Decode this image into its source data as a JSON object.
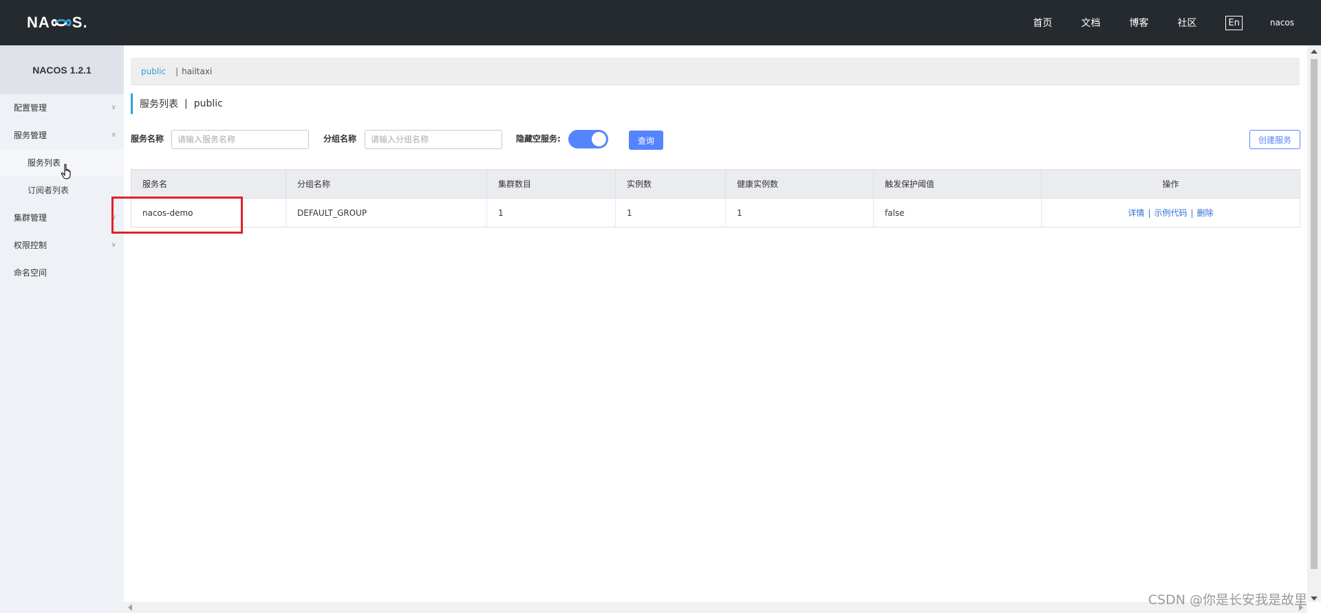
{
  "header": {
    "logo_text": "NACOS.",
    "nav": [
      "首页",
      "文档",
      "博客",
      "社区"
    ],
    "lang": "En",
    "user": "nacos"
  },
  "sidebar": {
    "title": "NACOS 1.2.1",
    "items": [
      {
        "label": "配置管理",
        "chevron": "chevron-down"
      },
      {
        "label": "服务管理",
        "chevron": "chevron-up"
      },
      {
        "label": "集群管理",
        "chevron": "chevron-down"
      },
      {
        "label": "权限控制",
        "chevron": "chevron-down"
      },
      {
        "label": "命名空间"
      }
    ],
    "sub_items": [
      "服务列表",
      "订阅者列表"
    ]
  },
  "namespace_bar": {
    "active": "public",
    "other": "hailtaxi",
    "sep": "|"
  },
  "page_title": {
    "label": "服务列表",
    "sep": "|",
    "namespace": "public"
  },
  "filter": {
    "service_name_label": "服务名称",
    "service_name_placeholder": "请输入服务名称",
    "group_name_label": "分组名称",
    "group_name_placeholder": "请输入分组名称",
    "hide_empty_label": "隐藏空服务:",
    "hide_empty_on": true,
    "query_label": "查询",
    "create_label": "创建服务"
  },
  "table": {
    "headers": [
      "服务名",
      "分组名称",
      "集群数目",
      "实例数",
      "健康实例数",
      "触发保护阈值",
      "操作"
    ],
    "rows": [
      {
        "service": "nacos-demo",
        "group": "DEFAULT_GROUP",
        "clusters": "1",
        "instances": "1",
        "healthy": "1",
        "threshold": "false",
        "ops": [
          "详情",
          "示例代码",
          "删除"
        ]
      }
    ],
    "op_sep": "|"
  },
  "watermark": "CSDN @你是长安我是故里",
  "colors": {
    "header_bg": "#252a2f",
    "sidebar_bg": "#eef1f5",
    "accent": "#2f9fd8",
    "primary": "#5584ff",
    "highlight_box": "#e0202a"
  }
}
